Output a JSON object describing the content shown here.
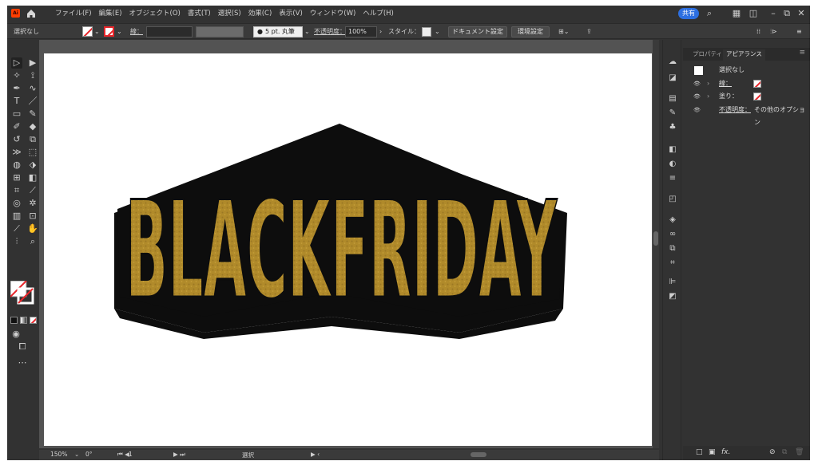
{
  "app": {
    "logo_text": "Ai"
  },
  "menu": [
    "ファイル(F)",
    "編集(E)",
    "オブジェクト(O)",
    "書式(T)",
    "選択(S)",
    "効果(C)",
    "表示(V)",
    "ウィンドウ(W)",
    "ヘルプ(H)"
  ],
  "menubar_right": {
    "share_label": "共有"
  },
  "control_bar": {
    "selection_label": "選択なし",
    "stroke_label": "線：",
    "brush_label": "5 pt. 丸筆",
    "opacity_label": "不透明度：",
    "opacity_value": "100%",
    "style_label": "スタイル：",
    "doc_settings_button": "ドキュメント設定",
    "preferences_button": "環境設定"
  },
  "canvas": {
    "artwork_text": "BLACKFRIDAY",
    "artwork_colors": {
      "fill": "#b08a2a",
      "shadow": "#0d0d0d"
    }
  },
  "status_bar": {
    "zoom": "150%",
    "rotation": "0°",
    "artboard": "1",
    "tool": "選択"
  },
  "panel": {
    "tabs": [
      "プロパティ",
      "アピアランス"
    ],
    "active_tab": "アピアランス",
    "rows": {
      "header": "選択なし",
      "stroke": "線：",
      "fill": "塗り：",
      "opacity": "不透明度：",
      "opacity_value": "その他のオプション"
    }
  }
}
